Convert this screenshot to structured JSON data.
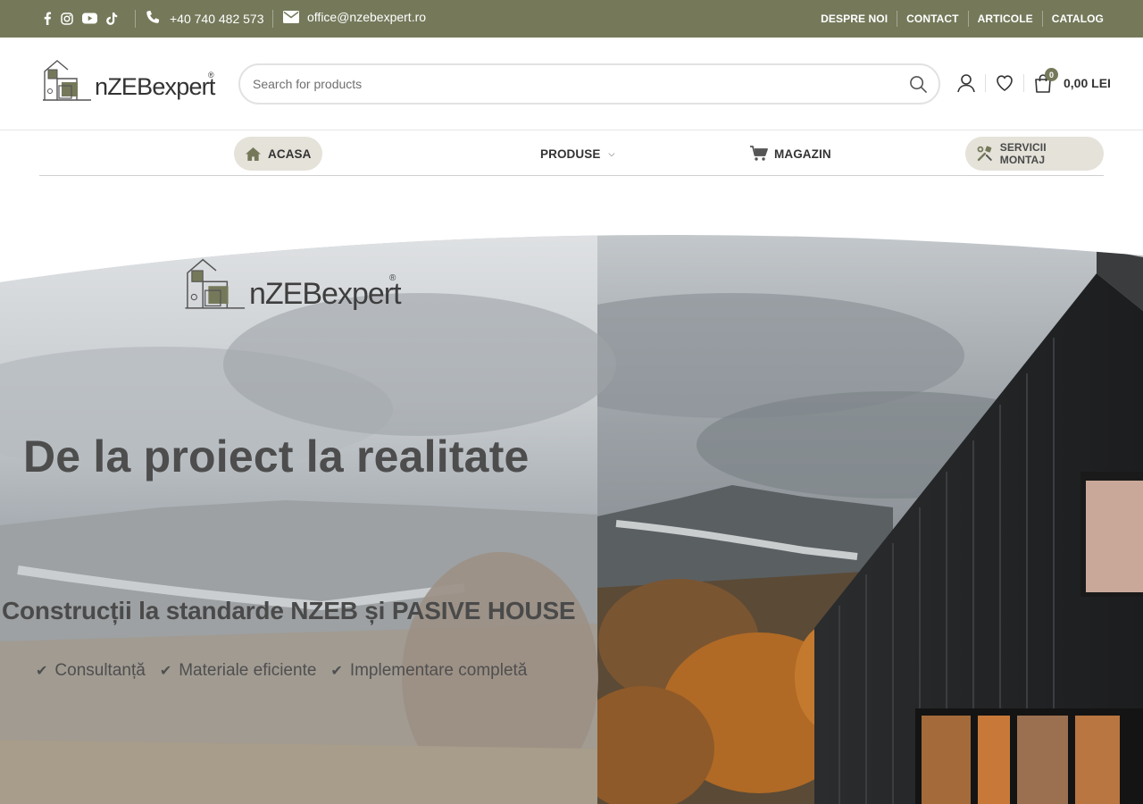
{
  "topbar": {
    "phone": "+40 740 482 573",
    "email": "office@nzebexpert.ro",
    "social_icons": [
      "facebook-icon",
      "instagram-icon",
      "youtube-icon",
      "tiktok-icon"
    ],
    "links": [
      "DESPRE NOI",
      "CONTACT",
      "ARTICOLE",
      "CATALOG"
    ],
    "background": "#75795a"
  },
  "header": {
    "logo_text": "nZEBexpert",
    "logo_reg": "®",
    "search_placeholder": "Search for products",
    "cart_count": "0",
    "cart_total": "0,00 LEI"
  },
  "nav": {
    "items": [
      {
        "label": "ACASA",
        "icon": "home-icon"
      },
      {
        "label": "PRODUSE",
        "icon": "chevron-down-icon"
      },
      {
        "label": "MAGAZIN",
        "icon": "cart-icon"
      },
      {
        "label": "SERVICII MONTAJ",
        "icon": "tools-icon"
      }
    ]
  },
  "hero": {
    "logo_text": "nZEBexpert",
    "logo_reg": "®",
    "title": "De la proiect la realitate",
    "subtitle": "Construcții la standarde NZEB și PASIVE HOUSE",
    "checks": [
      "Consultanță",
      "Materiale eficiente",
      "Implementare completă"
    ]
  },
  "colors": {
    "accent": "#75795a",
    "pill": "#e4e2d9",
    "text_dark": "#333333"
  }
}
